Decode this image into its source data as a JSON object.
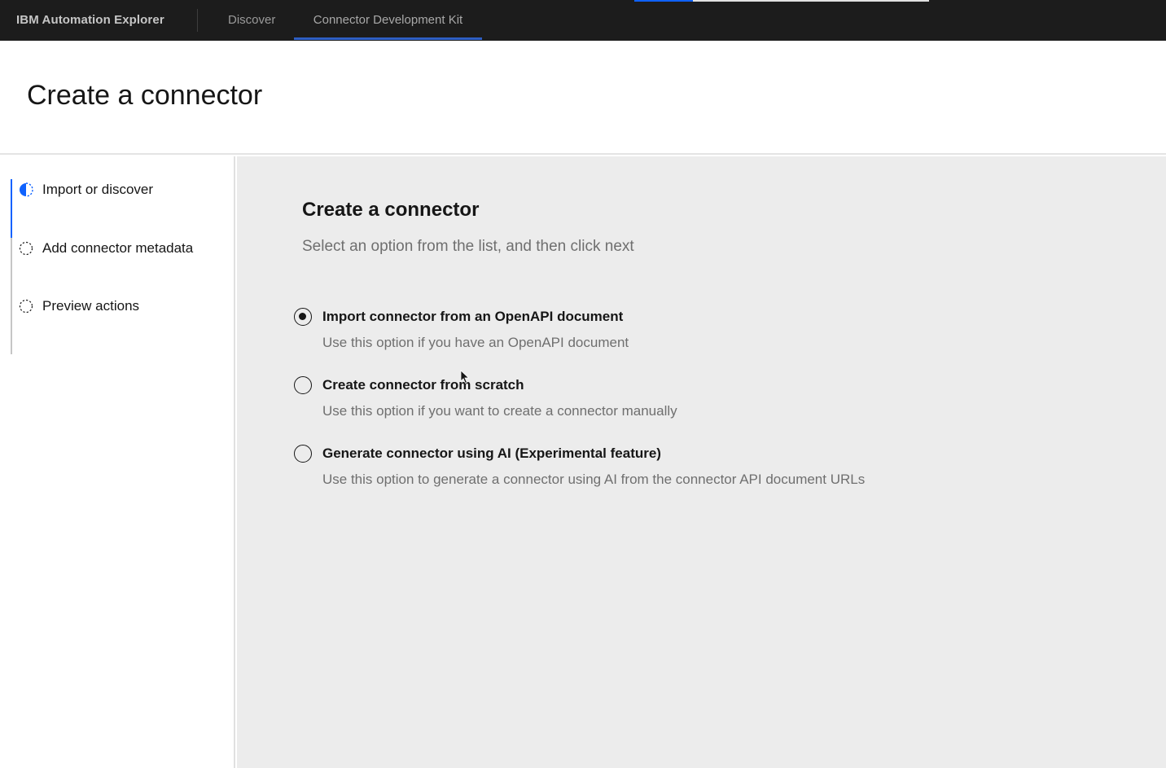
{
  "header": {
    "brand": "IBM Automation Explorer",
    "nav": [
      {
        "label": "Discover"
      },
      {
        "label": "Connector Development Kit",
        "active": true
      }
    ],
    "accent_color": "#0f62fe"
  },
  "page": {
    "title": "Create a connector"
  },
  "sidebar": {
    "steps": [
      {
        "label": "Import or discover",
        "state": "current",
        "icon": "half-filled-circle-icon"
      },
      {
        "label": "Add connector metadata",
        "state": "incomplete",
        "icon": "dashed-circle-icon"
      },
      {
        "label": "Preview actions",
        "state": "incomplete",
        "icon": "dashed-circle-icon"
      }
    ]
  },
  "main": {
    "title": "Create a connector",
    "subtitle": "Select an option from the list, and then click next",
    "options": [
      {
        "label": "Import connector from an OpenAPI document",
        "description": "Use this option if you have an OpenAPI document",
        "selected": true
      },
      {
        "label": "Create connector from scratch",
        "description": "Use this option if you want to create a connector manually",
        "selected": false
      },
      {
        "label": "Generate connector using AI (Experimental feature)",
        "description": "Use this option to generate a connector using AI from the connector API document URLs",
        "selected": false
      }
    ]
  }
}
